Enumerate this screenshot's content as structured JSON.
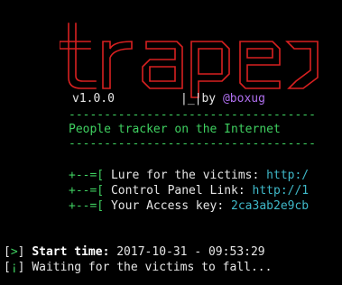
{
  "banner": {
    "logo_text": "trape",
    "version": "v1.0.0",
    "by": "|_|by",
    "author": "@boxug",
    "separator": "-----------------------------------",
    "tagline": "People tracker on the Internet"
  },
  "links": [
    {
      "prefix": "+--=[",
      "label": "Lure for the victims:",
      "value": "http:/"
    },
    {
      "prefix": "+--=[",
      "label": "Control Panel Link:",
      "value": "http://1"
    },
    {
      "prefix": "+--=[",
      "label": "Your Access key:",
      "value": "2ca3ab2e9cb"
    }
  ],
  "status": {
    "start_prefix": "[>]",
    "start_label": "Start time:",
    "start_value": "2017-10-31 - 09:53:29",
    "wait_prefix": "[¡]",
    "wait_text": "Waiting for the victims to fall..."
  },
  "colors": {
    "red": "#d82020",
    "green": "#3fd060",
    "cyan": "#3fb8c8",
    "purple": "#b070f0"
  }
}
